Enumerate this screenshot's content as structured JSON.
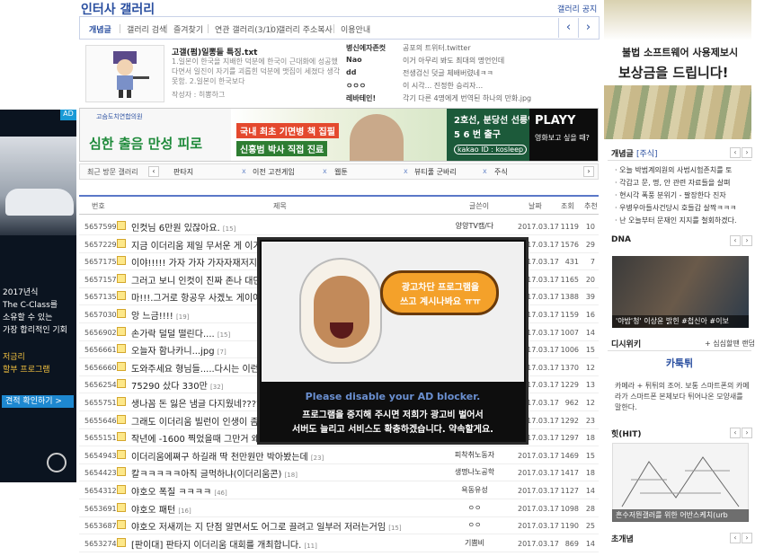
{
  "header": {
    "title": "인터사 갤러리",
    "notice_link": "갤러리 공지"
  },
  "tabs": [
    {
      "label": "개념글",
      "active": true
    },
    {
      "label": "갤러리 검색"
    },
    {
      "label": "즐겨찾기"
    },
    {
      "label": "연관 갤러리(3/10)"
    },
    {
      "label": "갤러리 주소복사"
    },
    {
      "label": "이용안내"
    }
  ],
  "featured": {
    "title": "고갤(펌)일뽕들 특징.txt",
    "desc": "1.일본이 한국을 지배한 덕분에 한국이 근대화에 성공했다면서 일진이 자기를 괴롭힌 덕분에 맷집이 세졌다 생각 못함. 2.일본이 한국보다",
    "author": "작성자 : 히뽕하그"
  },
  "popular_list": [
    {
      "k": "병신에자존컷",
      "v": "공포의 트위터.twitter"
    },
    {
      "k": "Nao",
      "v": "이거 아무리 봐도 최대의 명언인데"
    },
    {
      "k": "dd",
      "v": "전생검신 덧글 체배버렸네ㅋㅋ"
    },
    {
      "k": "ㅇㅇㅇ",
      "v": "이 시각... 진정한 승리자..."
    },
    {
      "k": "레바테인!",
      "v": "각기 다른 4명에게 번역된 하나의 만화.jpg"
    }
  ],
  "banner": {
    "hospital": "고슴도치연합의원",
    "slogan": "심한 출음 만성 피로",
    "badge1": "국내 최초 기면병 책 집필",
    "badge2": "신홍범 박사 직접 진료",
    "line2_a": "2호선, 분당선 선릉역",
    "line2_b": "5 6 번 출구",
    "kakao": "kakao ID : kosleep",
    "play": "PLAYY",
    "play_sub": "영화보고 싶을 때?"
  },
  "recent": {
    "label": "최근 방문 갤러리",
    "items": [
      "판타지",
      "이전 고전게임",
      "웹툰",
      "뷰티풀 군바리",
      "주식"
    ]
  },
  "table_header": {
    "no": "번호",
    "title": "제목",
    "author": "글쓴이",
    "date": "날짜",
    "views": "조회",
    "rec": "추천"
  },
  "rows": [
    {
      "no": "5657599",
      "title": "인컷님 6만원 있잖아요.",
      "c": "[15]",
      "author": "양양TV캠/다",
      "date": "2017.03.17",
      "views": "1119",
      "rec": "10"
    },
    {
      "no": "5657229",
      "title": "지금 이더리움 제일 무서운 게 이거",
      "c": "",
      "author": "",
      "date": "2017.03.17",
      "views": "1576",
      "rec": "29"
    },
    {
      "no": "5657175",
      "title": "이야!!!!! 가자 가자 가자자재저지자",
      "c": "",
      "author": "",
      "date": "2017.03.17",
      "views": "431",
      "rec": "7"
    },
    {
      "no": "5657157",
      "title": "그러고 보니 인컷이 진짜 존나 대단",
      "c": "",
      "author": "",
      "date": "2017.03.17",
      "views": "1165",
      "rec": "20"
    },
    {
      "no": "5657135",
      "title": "마!!!.그거로 항공우 사겠노 게이야",
      "c": "",
      "author": "",
      "date": "2017.03.17",
      "views": "1388",
      "rec": "39"
    },
    {
      "no": "5657030",
      "title": "앙 느금!!!!",
      "c": "[19]",
      "author": "",
      "date": "2017.03.17",
      "views": "1159",
      "rec": "16"
    },
    {
      "no": "5656902",
      "title": "손가락 덜덜 떨린다....",
      "c": "[15]",
      "author": "",
      "date": "2017.03.17",
      "views": "1007",
      "rec": "14"
    },
    {
      "no": "5656661",
      "title": "오늘자 함나카니...jpg",
      "c": "[7]",
      "author": "",
      "date": "2017.03.17",
      "views": "1006",
      "rec": "15"
    },
    {
      "no": "5656660",
      "title": "도와주세요 형님들.....다시는 이런게",
      "c": "",
      "author": "",
      "date": "2017.03.17",
      "views": "1370",
      "rec": "12"
    },
    {
      "no": "5656254",
      "title": "75290 샀다 330만",
      "c": "[32]",
      "author": "",
      "date": "2017.03.17",
      "views": "1229",
      "rec": "13"
    },
    {
      "no": "5655751",
      "title": "생나꼼 돈 잃은 냄글 다지웠네????",
      "c": "",
      "author": "",
      "date": "2017.03.17",
      "views": "962",
      "rec": "12"
    },
    {
      "no": "5655646",
      "title": "그래도 이더리움 빌런이 인생이 좀",
      "c": "",
      "author": "",
      "date": "2017.03.17",
      "views": "1292",
      "rec": "23"
    },
    {
      "no": "5655151",
      "title": "작년에 -1600 찍었을때 그만거 왜",
      "c": "",
      "author": "",
      "date": "2017.03.17",
      "views": "1297",
      "rec": "18"
    },
    {
      "no": "5654943",
      "title": "이더리움에쪄구 하길래 딱 천만원만 박아봤는데",
      "c": "[23]",
      "author": "피착취노동자",
      "date": "2017.03.17",
      "views": "1469",
      "rec": "15"
    },
    {
      "no": "5654423",
      "title": "칼ㅋㅋㅋㅋㅋ아직 글먹하냐(이더리움콘)",
      "c": "[18]",
      "author": "생명나노공학",
      "date": "2017.03.17",
      "views": "1417",
      "rec": "18"
    },
    {
      "no": "5654312",
      "title": "야호오 폭질 ㅋㅋㅋㅋ",
      "c": "[46]",
      "author": "욕동유성",
      "date": "2017.03.17",
      "views": "1127",
      "rec": "14"
    },
    {
      "no": "5653691",
      "title": "야호오 패턴",
      "c": "[16]",
      "author": "ㅇㅇ",
      "date": "2017.03.17",
      "views": "1098",
      "rec": "28"
    },
    {
      "no": "5653687",
      "title": "야호오 저새끼는 지 단점 알면서도 어그로 끌려고 일부러 저러는거임",
      "c": "[15]",
      "author": "ㅇㅇ",
      "date": "2017.03.17",
      "views": "1190",
      "rec": "25"
    },
    {
      "no": "5653274",
      "title": "[판이대] 판타지 이더리움 대회를 개최합니다.",
      "c": "[11]",
      "author": "기쁨비",
      "date": "2017.03.17",
      "views": "869",
      "rec": "14"
    }
  ],
  "adblock": {
    "bubble1": "광고차단 프로그램을",
    "bubble2": "쓰고 계시나봐요 ㅠㅠ",
    "english": "Please disable your AD blocker.",
    "korean1": "프로그램을 중지해 주시면 저희가 광고비 벌어서",
    "korean2": "서버도 늘리고 서비스도 확충하겠습니다. 약속할게요."
  },
  "left_ad": {
    "flag": "AD",
    "line1": "2017년식",
    "line2": "The C-Class를",
    "line3": "소유할 수 있는",
    "line4": "가장 합리적인 기회",
    "line5": "저금리",
    "line6": "할부 프로그램",
    "button": "견적 확인하기 >"
  },
  "right_ad": {
    "line1": "불법 소프트웨어 사용제보시",
    "line2": "보상금을 드립니다!"
  },
  "sidebar": {
    "concept_title": "개념글",
    "concept_sub": "[주식]",
    "concept_items": [
      "· 오늘 박범계의원의 사법시험존치를 토",
      "· 각갑고 문, 명, 안 관련 자료들을 살펴",
      "· 현시각 폭풍 분위기 - 팔장한다 진자",
      "· 우병우아들사건당시 호들갑 살짝ㅋㅋㅋ",
      "· 난 오늘부터 문재인 지지를 철회하겠다."
    ],
    "dna_title": "DNA",
    "dna_caption": "'야밤'청' 이상윤 밝힌 #첩신아 #이보",
    "digiwiki_title": "디시위키",
    "digiwiki_link": "+ 심심할땐 랜덤",
    "cartoon": "카툭튀",
    "cartoon_desc": "카메라 + 튀튀의 조어. 보통 스마트폰의 카메라가 스마트폰 본체보다 튀어나온 모양새를 말한다.",
    "hit_title": "힛(HIT)",
    "hit_caption": "흔수저뭔갤러를 위한 어반스케치(urb",
    "concept2_title": "초개념"
  }
}
